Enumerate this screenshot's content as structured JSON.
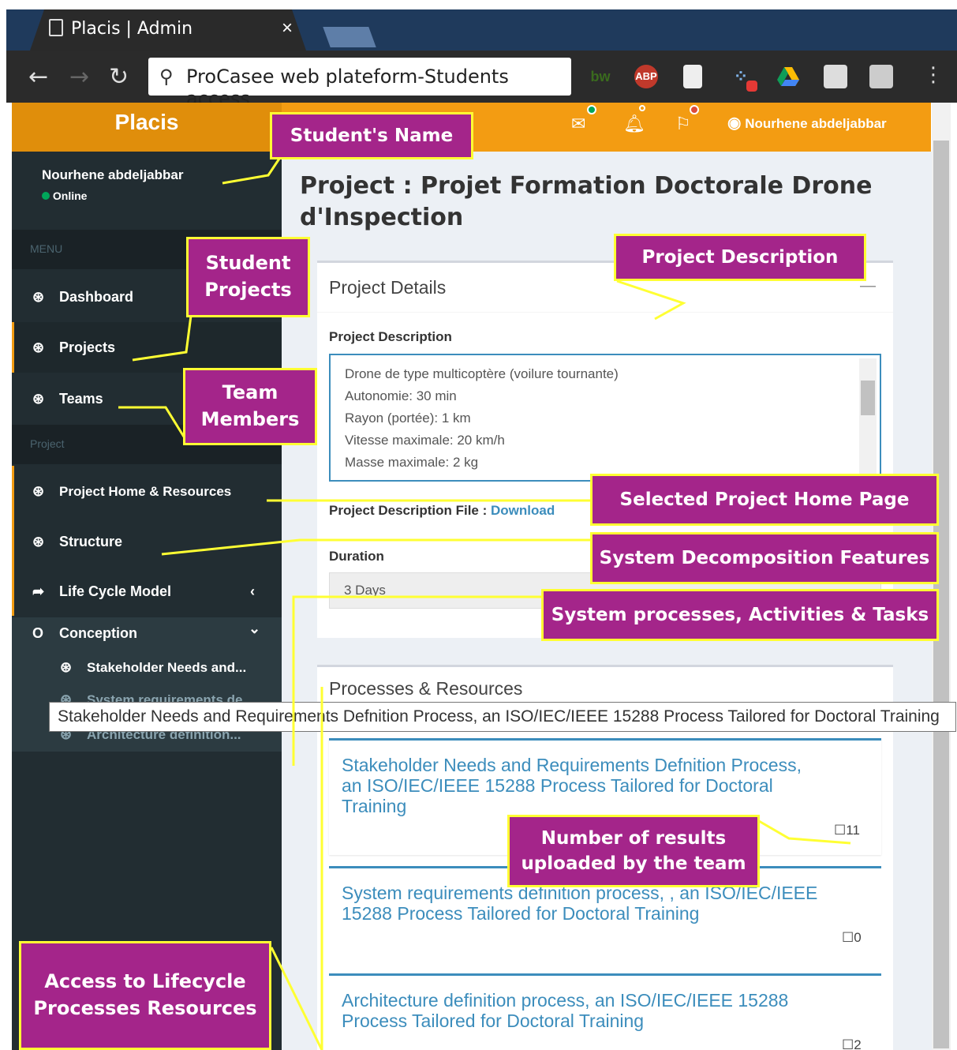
{
  "browser": {
    "tab_title": "Placis | Admin",
    "tab_close": "×",
    "address": "ProCasee web plateform-Students access",
    "extensions": {
      "bw": "bw",
      "abp": "ABP"
    }
  },
  "app": {
    "logo": "Placis",
    "header_user": "Nourhene abdeljabbar",
    "accent_color": "#f39c12"
  },
  "sidebar": {
    "user_name": "Nourhene abdeljabbar",
    "status": "Online",
    "menu_header": "MENU",
    "items": [
      {
        "label": "Dashboard",
        "icon": "dashboard-icon"
      },
      {
        "label": "Projects",
        "icon": "dashboard-icon"
      },
      {
        "label": "Teams",
        "icon": "dashboard-icon"
      }
    ],
    "project_header": "Project",
    "project_items": [
      {
        "label": "Project Home & Resources",
        "icon": "dashboard-icon"
      },
      {
        "label": "Structure",
        "icon": "dashboard-icon"
      },
      {
        "label": "Life Cycle Model",
        "icon": "share-icon",
        "caret": "‹"
      },
      {
        "label": "Conception",
        "icon": "circle-icon",
        "caret": "⌄"
      },
      {
        "label": "Stakeholder Needs and...",
        "icon": "dashboard-icon"
      },
      {
        "label": "System requirements de...",
        "icon": "dashboard-icon"
      },
      {
        "label": "Architecture definition...",
        "icon": "dashboard-icon"
      }
    ]
  },
  "main": {
    "page_title_line1": "Project : Projet Formation Doctorale Drone",
    "page_title_line2": "d'Inspection",
    "details": {
      "title": "Project Details",
      "collapse": "—",
      "desc_label": "Project Description",
      "desc_lines": [
        "Drone de type multicoptère (voilure tournante)",
        "Autonomie: 30 min",
        "Rayon (portée): 1 km",
        "Vitesse maximale: 20 km/h",
        "Masse maximale: 2 kg"
      ],
      "file_label": "Project Description File : ",
      "file_link": "Download",
      "duration_label": "Duration",
      "duration_value": "3 Days"
    },
    "processes": {
      "title": "Processes & Resources",
      "items": [
        {
          "line1": "Stakeholder Needs and Requirements Defnition Process,",
          "line2": "an ISO/IEC/IEEE 15288 Process Tailored for Doctoral",
          "line3": "Training",
          "count": "11"
        },
        {
          "line1": "System requirements definition process, , an ISO/IEC/IEEE",
          "line2": "15288 Process Tailored for Doctoral Training",
          "line3": "",
          "count": "0"
        },
        {
          "line1": "Architecture definition process, an ISO/IEC/IEEE 15288",
          "line2": "Process Tailored for Doctoral Training",
          "line3": "",
          "count": "2"
        }
      ]
    }
  },
  "tooltip": "Stakeholder Needs and Requirements Defnition Process, an ISO/IEC/IEEE 15288 Process Tailored for Doctoral Training",
  "callouts": {
    "student_name": "Student's Name",
    "student_projects_1": "Student",
    "student_projects_2": "Projects",
    "team_members_1": "Team",
    "team_members_2": "Members",
    "project_description": "Project Description",
    "selected_home": "Selected Project Home Page",
    "decomposition": "System Decomposition Features",
    "processes": "System processes, Activities & Tasks",
    "results_1": "Number of results",
    "results_2": "uploaded by the team",
    "lifecycle_1": "Access to Lifecycle",
    "lifecycle_2": "Processes Resources"
  },
  "callout_colors": {
    "fill": "#a4258a",
    "border": "#ffff33"
  }
}
